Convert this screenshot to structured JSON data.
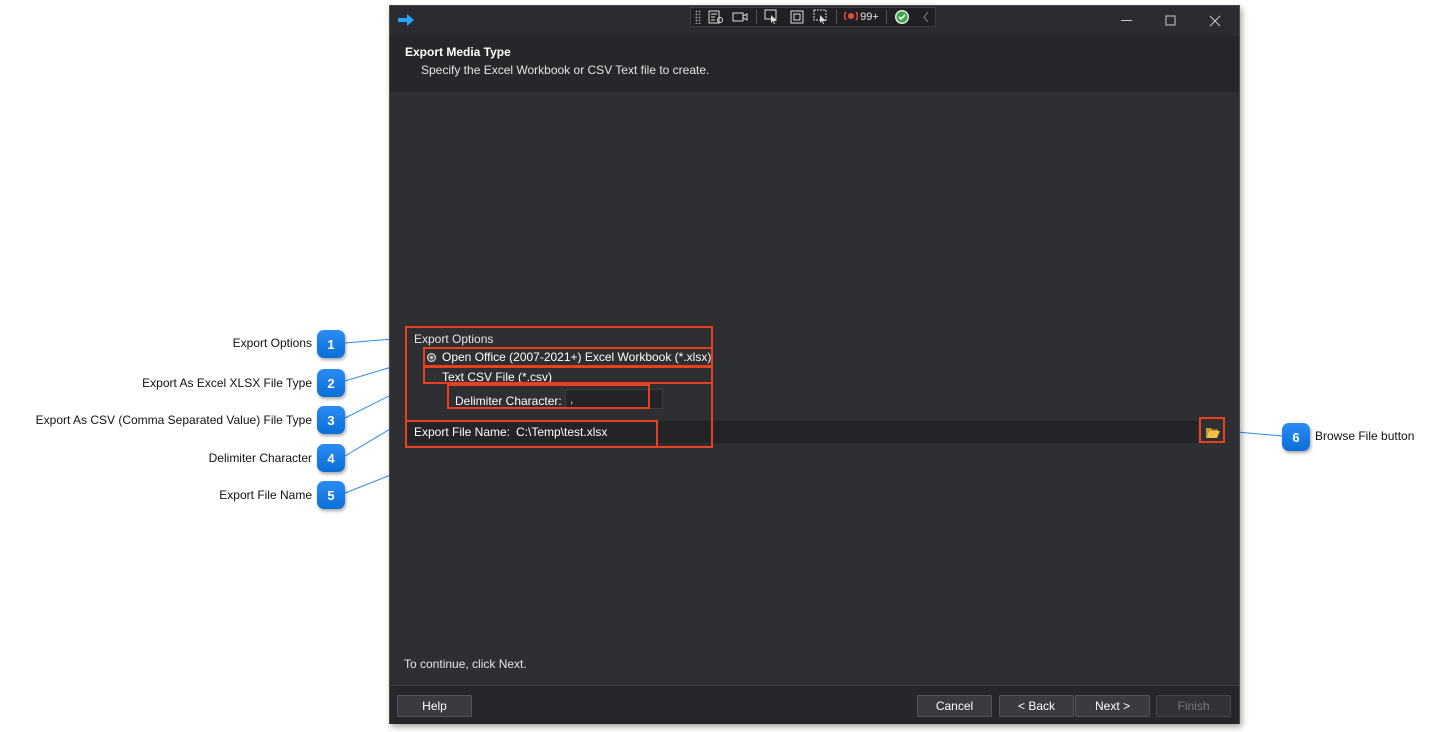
{
  "window": {
    "toolbar_count": "99+"
  },
  "header": {
    "title": "Export Media Type",
    "subtitle": "Specify the Excel Workbook or CSV Text file to create."
  },
  "export_options": {
    "caption": "Export Options",
    "option_xlsx": "Open Office (2007-2021+) Excel Workbook (*.xlsx)",
    "option_csv": "Text CSV File (*.csv)",
    "selected": "xlsx",
    "delimiter_label": "Delimiter Character:",
    "delimiter_value": ",",
    "file_name_label": "Export File Name:",
    "file_name_value": "C:\\Temp\\test.xlsx"
  },
  "footer": {
    "hint": "To continue, click Next.",
    "help": "Help",
    "cancel": "Cancel",
    "back": "< Back",
    "next": "Next >",
    "finish": "Finish"
  },
  "callouts": [
    {
      "number": "1",
      "label": "Export Options"
    },
    {
      "number": "2",
      "label": "Export As Excel XLSX File Type"
    },
    {
      "number": "3",
      "label": "Export As CSV (Comma Separated Value) File Type"
    },
    {
      "number": "4",
      "label": "Delimiter Character"
    },
    {
      "number": "5",
      "label": "Export File Name"
    },
    {
      "number": "6",
      "label": "Browse File button"
    }
  ],
  "colors": {
    "accent": "#0a6fd8",
    "highlight": "#e8411f",
    "window_bg": "#2e2f33"
  }
}
